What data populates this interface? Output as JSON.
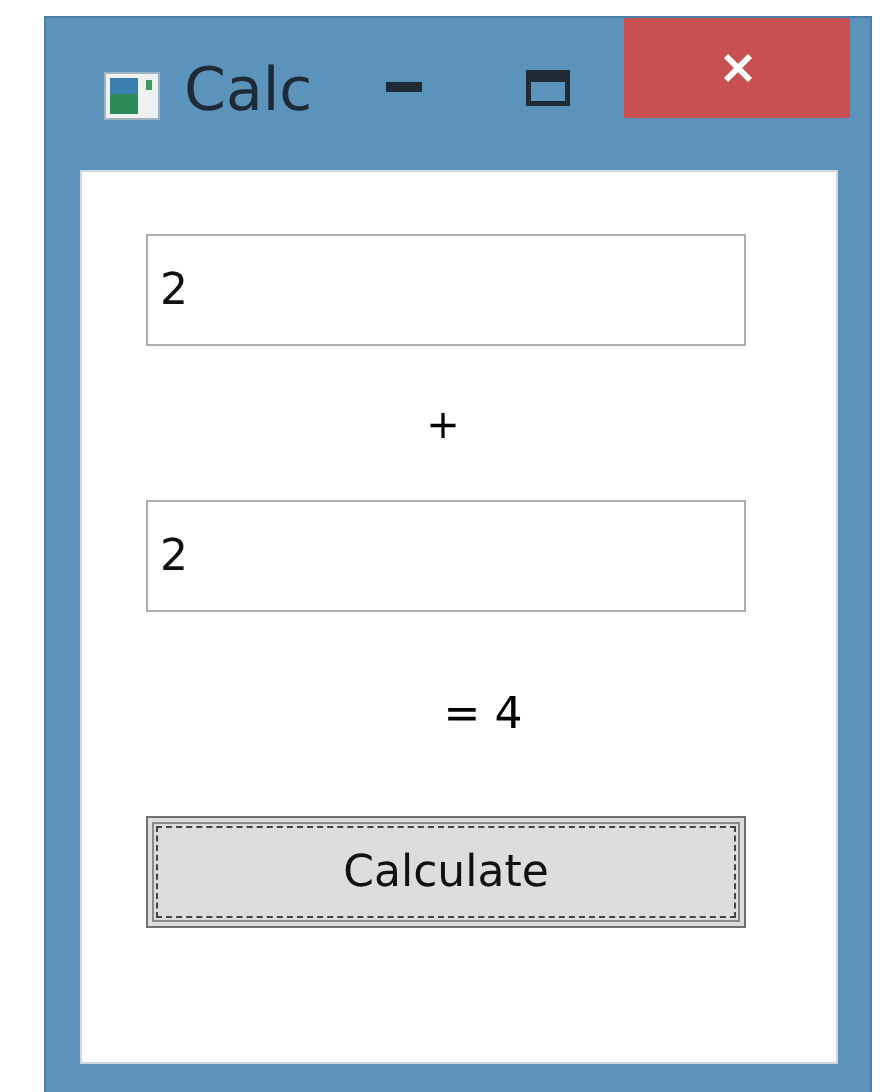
{
  "window": {
    "title": "Calc"
  },
  "fields": [
    {
      "value": "2"
    },
    {
      "value": "2"
    }
  ],
  "operator": "+",
  "result": "= 4",
  "button": {
    "label": "Calculate",
    "focused": true
  }
}
